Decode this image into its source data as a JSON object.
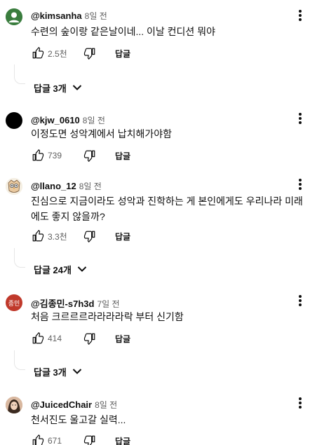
{
  "comments": [
    {
      "author": "@kimsanha",
      "time": "8일 전",
      "text": "수련의 숲이랑 같은날이네... 이날 컨디션 뭐야",
      "likes": "2.5천",
      "reply_label": "답글",
      "replies_label": "답글 3개",
      "avatar": "default-green-avatar"
    },
    {
      "author": "@kjw_0610",
      "time": "8일 전",
      "text": "이정도면 성악계에서 납치해가야함",
      "likes": "739",
      "reply_label": "답글",
      "avatar": "black-circle-avatar"
    },
    {
      "author": "@llano_12",
      "time": "8일 전",
      "text": "진심으로 지금이라도 성악과 진학하는 게 본인에게도 우리나라 미래에도 좋지 않을까?",
      "likes": "3.3천",
      "reply_label": "답글",
      "replies_label": "답글 24개",
      "avatar": "owl-avatar"
    },
    {
      "author": "@김종민-s7h3d",
      "time": "7일 전",
      "text": "처음 크르르르라라라라락 부터 신기함",
      "likes": "414",
      "reply_label": "답글",
      "replies_label": "답글 3개",
      "avatar_text": "종민"
    },
    {
      "author": "@JuicedChair",
      "time": "8일 전",
      "text": "천서진도 울고갈 실력...",
      "likes": "671",
      "reply_label": "답글",
      "avatar": "photo-avatar"
    }
  ],
  "colors": {
    "text": "#0f0f0f",
    "secondary": "#606060",
    "avatar_text_bg": "#c0392b",
    "thread_line": "#e5e5e5"
  }
}
